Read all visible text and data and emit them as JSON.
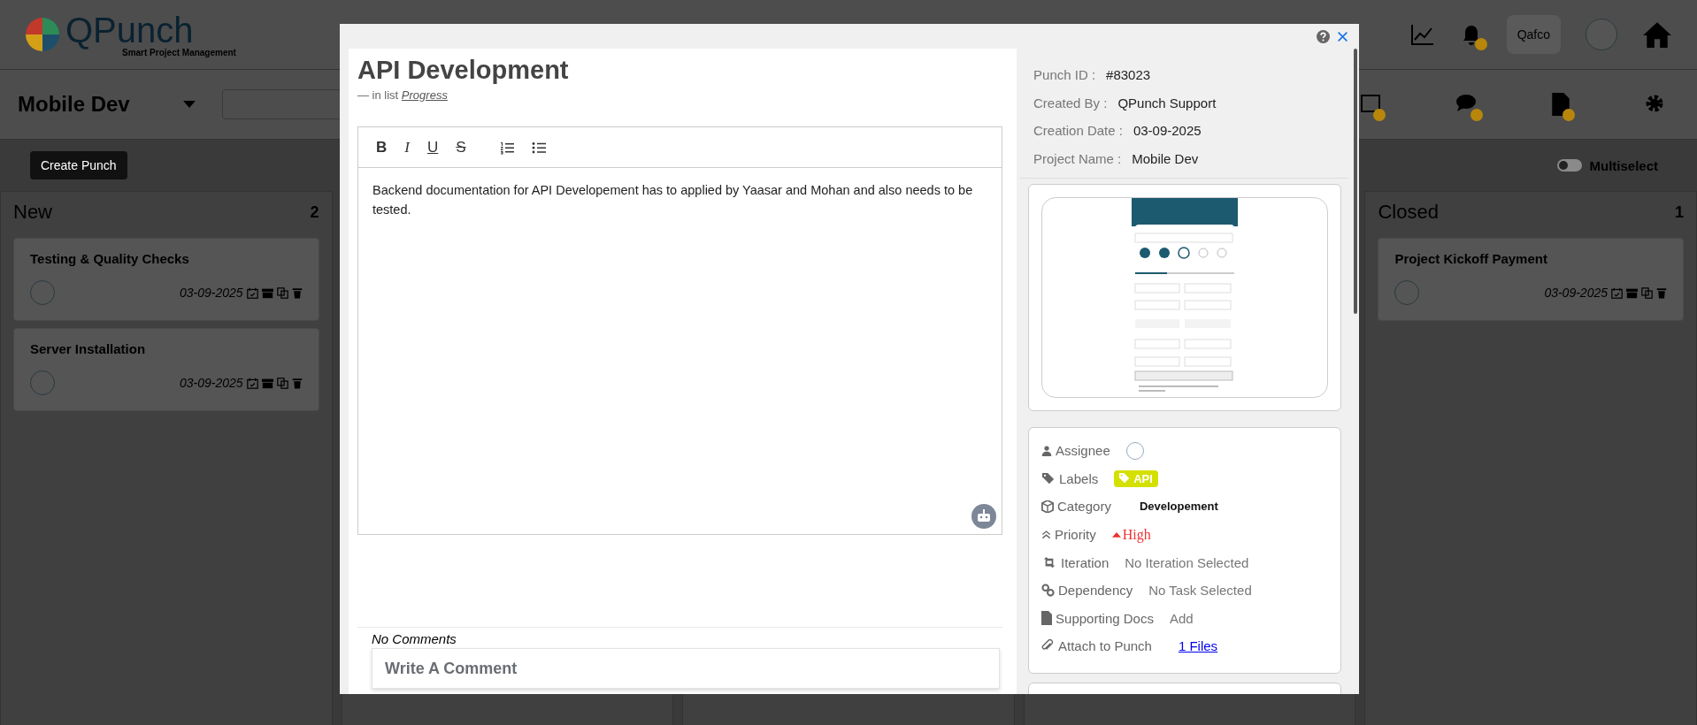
{
  "header": {
    "brand": "QPunch",
    "tagline": "Smart Project Management",
    "workspace": "Qafco"
  },
  "project_selector": {
    "value": "Mobile Dev"
  },
  "create_button": "Create Punch",
  "multiselect": {
    "label": "Multiselect",
    "on": false
  },
  "columns": [
    {
      "title": "New",
      "count": "2",
      "cards": [
        {
          "title": "Testing & Quality Checks",
          "date": "03-09-2025"
        },
        {
          "title": "Server Installation",
          "date": "03-09-2025"
        }
      ]
    },
    {
      "title": "Closed",
      "count": "1",
      "cards": [
        {
          "title": "Project Kickoff Payment",
          "date": "03-09-2025"
        }
      ]
    }
  ],
  "punch": {
    "title": "API Development",
    "list_prefix": "— in list",
    "list_name": "Progress",
    "toolbar": [
      {
        "kind": "bold",
        "label": "B"
      },
      {
        "kind": "italic",
        "label": "I"
      },
      {
        "kind": "underline",
        "label": "U"
      },
      {
        "kind": "strike",
        "label": "S"
      },
      {
        "kind": "ordered"
      },
      {
        "kind": "bullet"
      }
    ],
    "description": "Backend documentation for API Developement has to applied by Yaasar and Mohan and also needs to be tested.",
    "comments_status": "No Comments",
    "comment_placeholder": "Write A Comment",
    "info": [
      {
        "label": "Punch ID :",
        "value": "#83023"
      },
      {
        "label": "Created By :",
        "value": "QPunch Support"
      },
      {
        "label": "Creation Date :",
        "value": "03-09-2025"
      },
      {
        "label": "Project Name :",
        "value": "Mobile Dev"
      }
    ],
    "attributes": [
      {
        "kind": "assignee",
        "label": "Assignee"
      },
      {
        "kind": "labels",
        "label": "Labels",
        "value": "API"
      },
      {
        "kind": "category",
        "label": "Category",
        "value": "Developement"
      },
      {
        "kind": "priority",
        "label": "Priority",
        "value": "High"
      },
      {
        "kind": "iteration",
        "label": "Iteration",
        "value": "No Iteration Selected"
      },
      {
        "kind": "dependency",
        "label": "Dependency",
        "value": "No Task Selected"
      },
      {
        "kind": "docs",
        "label": "Supporting Docs",
        "value": "Add"
      },
      {
        "kind": "attach",
        "label": "Attach to Punch",
        "value": "1 Files"
      }
    ]
  }
}
